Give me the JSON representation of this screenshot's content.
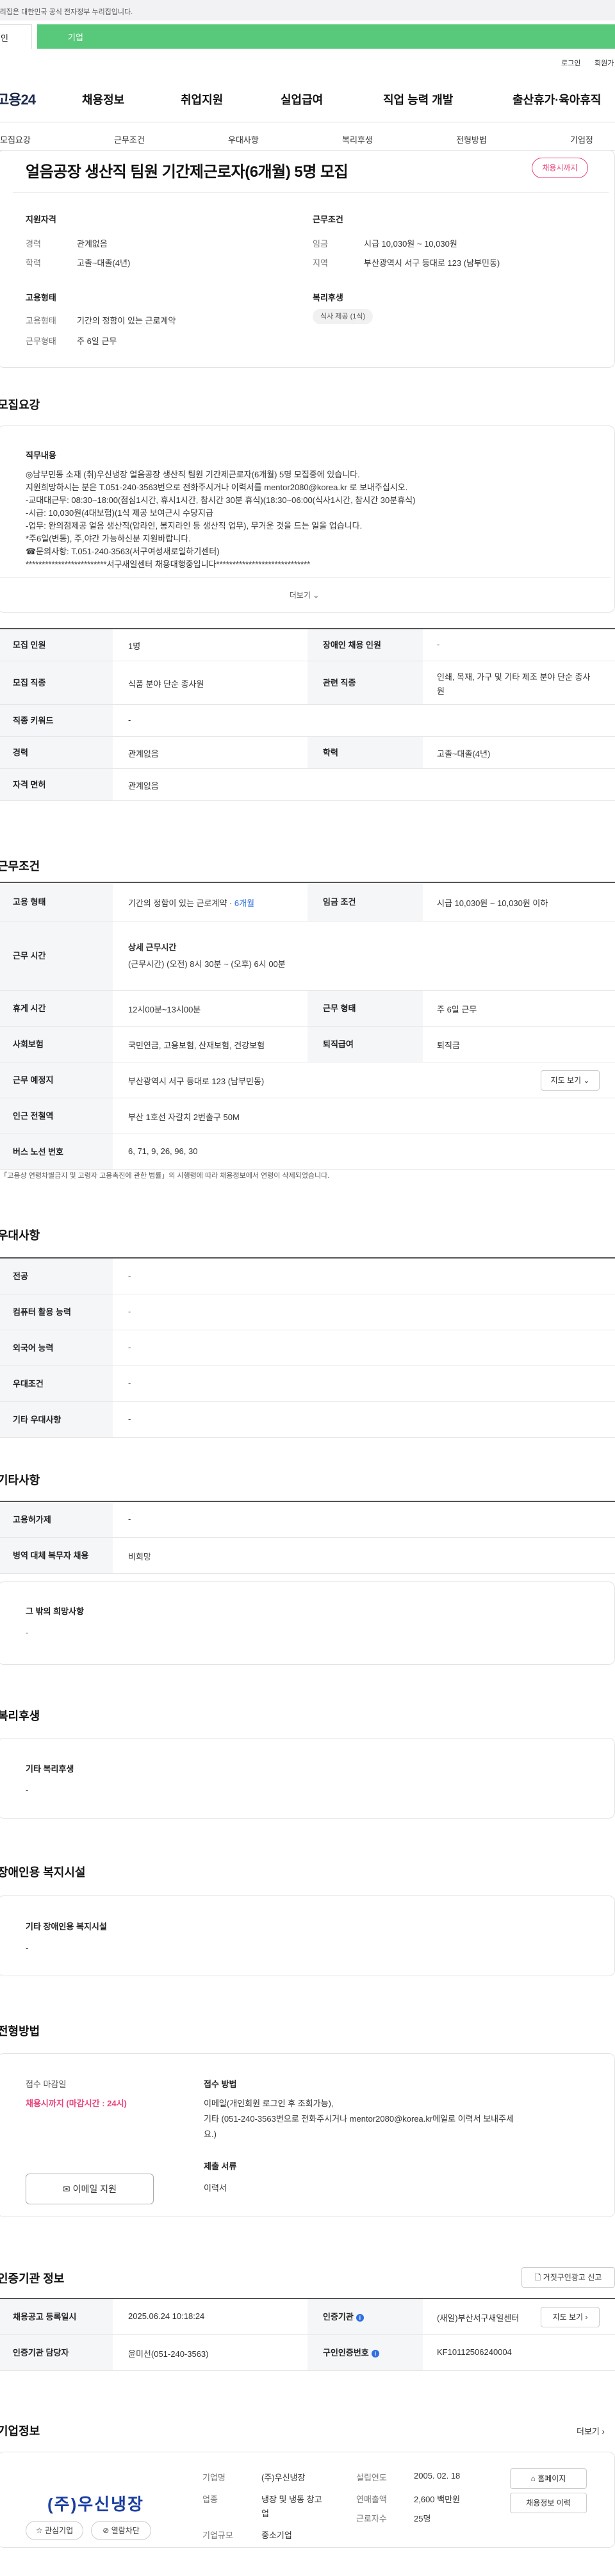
{
  "gov_banner": "·리집은 대한민국 공식 전자정부 누리집입니다.",
  "tabs": {
    "personal": "인",
    "company": "기업"
  },
  "util": {
    "login": "로그인",
    "join": "회원가"
  },
  "header": {
    "logo": "고용24",
    "gnb": [
      "채용정보",
      "취업지원",
      "실업급여",
      "직업 능력 개발",
      "출산휴가·육아휴직"
    ],
    "subnav": [
      "모집요강",
      "근무조건",
      "우대사항",
      "복리후생",
      "전형방법",
      "기업정"
    ]
  },
  "summary": {
    "title": "얼음공장 생산직 팀원 기간제근로자(6개월) 5명 모집",
    "badge": "채용시까지",
    "qual_head": "지원자격",
    "exp_label": "경력",
    "exp_value": "관계없음",
    "edu_label": "학력",
    "edu_value": "고졸~대졸(4년)",
    "cond_head": "근무조건",
    "wage_label": "임금",
    "wage_value": "시급 10,030원 ~ 10,030원",
    "area_label": "지역",
    "area_value": "부산광역시 서구 등대로 123 (남부민동)",
    "emp_head": "고용형태",
    "type_label": "고용형태",
    "type_value": "기간의 정함이 있는 근로계약",
    "days_label": "근무형태",
    "days_value": "주 6일 근무",
    "welfare_head": "복리후생",
    "welfare_chip": "식사 제공 (1식)"
  },
  "recruit": {
    "section_title": "모집요강",
    "desc_head": "직무내용",
    "desc_lines": [
      "◎남부민동 소재 (취)우신냉장 얼음공장 생산직 팀원 기간제근로자(6개월) 5명 모집중에 있습니다.",
      "지원희망하시는 분은 T.051-240-3563번으로 전화주시거나 이력서를 mentor2080@korea.kr 로 보내주십시오.",
      "-교대대근무: 08:30~18:00(점심1시간, 휴시1시간, 참시간 30분 휴식)(18:30~06:00(식사1시간, 참시간 30분휴식)",
      "-시급: 10,030원(4대보험)(1식 제공 보여근시 수당지급",
      "-업무: 완의점제공 얼음 생산직(압라인, 봉지라인 등 생산직 업무), 무거운 것을 드는 일을 업습니다.",
      "*주6일(변동), 주,야간 가능하신분 지원바랍니다.",
      "☎문의사항: T.051-240-3563(서구여성새로일하기센터)",
      "*************************서구새일센터 채용대행중입니다*****************************"
    ],
    "more": "더보기",
    "rows": [
      {
        "l1": "모집 인원",
        "v1": "1명",
        "l2": "장애인 채용 인원",
        "v2": "-"
      },
      {
        "l1": "모집 직종",
        "v1": "식품 분야 단순 종사원",
        "l2": "관련 직종",
        "v2": "인쇄, 목재, 가구 및 기타 제조 분야 단순 종사원"
      },
      {
        "l1": "직종 키워드",
        "v1": "-"
      },
      {
        "l1": "경력",
        "v1": "관계없음",
        "l2": "학력",
        "v2": "고졸~대졸(4년)"
      },
      {
        "l1": "자격 면허",
        "v1": "관계없음"
      }
    ]
  },
  "conditions": {
    "section_title": "근무조건",
    "emp_type_label": "고용 형태",
    "emp_type_value": "기간의 정함이 있는 근로계약 ·",
    "emp_type_months": "6개월",
    "wage_label": "임금 조건",
    "wage_value": "시급 10,030원 ~ 10,030원 이하",
    "hours_label": "근무 시간",
    "hours_head": "상세 근무시간",
    "hours_value": "(근무시간) (오전) 8시 30분 ~ (오후) 6시 00분",
    "break_label": "휴게 시간",
    "break_value": "12시00분~13시00분",
    "form_label": "근무 형태",
    "form_value": "주 6일 근무",
    "insurance_label": "사회보험",
    "insurance_value": "국민연금, 고용보험, 산재보험, 건강보험",
    "severance_label": "퇴직급여",
    "severance_value": "퇴직금",
    "place_label": "근무 예정지",
    "place_value": "부산광역시 서구 등대로 123 (남부민동)",
    "map_btn": "지도 보기",
    "subway_label": "인근 전철역",
    "subway_value": "부산 1호선 자갈치 2번출구 50M",
    "bus_label": "버스 노선 번호",
    "bus_value": "6, 71, 9, 26, 96, 30",
    "note": "*「고용상 연령차별금지 및 고령자 고용촉진에 관한 법률」의 시행령에 따라 채용정보에서 연령이 삭제되었습니다."
  },
  "preference": {
    "section_title": "우대사항",
    "rows": [
      {
        "label": "전공",
        "value": "-"
      },
      {
        "label": "컴퓨터 활용 능력",
        "value": "-"
      },
      {
        "label": "외국어 능력",
        "value": "-"
      },
      {
        "label": "우대조건",
        "value": "-"
      },
      {
        "label": "기타 우대사항",
        "value": "-"
      }
    ]
  },
  "etc": {
    "section_title": "기타사항",
    "rows": [
      {
        "label": "고용허가제",
        "value": "-"
      },
      {
        "label": "병역 대체 복무자 채용",
        "value": "비희망"
      }
    ],
    "hope_head": "그 밖의 희망사항",
    "hope_value": "-"
  },
  "welfare": {
    "section_title": "복리후생",
    "head": "기타 복리후생",
    "value": "-"
  },
  "disability": {
    "section_title": "장애인용 복지시설",
    "head": "기타 장애인용 복지시설",
    "value": "-"
  },
  "selection": {
    "section_title": "전형방법",
    "deadline_head": "접수 마감일",
    "deadline_value": "채용시까지 (마감시간 : 24시)",
    "method_head": "접수 방법",
    "method_lines": [
      "이메일(개인회원 로그인 후 조회가능),",
      "기타 (051-240-3563번으로 전화주시거나 mentor2080@korea.kr메일로 이력서 보내주세",
      "요.)"
    ],
    "docs_head": "제출 서류",
    "docs_value": "이력서",
    "apply_btn": "이메일 지원"
  },
  "agency": {
    "section_title": "인증기관 정보",
    "report_btn": "거짓구인광고 신고",
    "reg_label": "채용공고 등록일시",
    "reg_value": "2025.06.24 10:18:24",
    "org_label": "인증기관",
    "org_value": "(새일)부산서구새일센터",
    "map_btn": "지도 보기",
    "manager_label": "인증기관 담당자",
    "manager_value": "윤미선(051-240-3563)",
    "number_label": "구인인증번호",
    "number_value": "KF10112506240004"
  },
  "company": {
    "section_title": "기업정보",
    "more": "더보기",
    "logo_text": "(주)우신냉장",
    "interest_btn": "관심기업",
    "block_btn": "열람차단",
    "name_label": "기업명",
    "name_value": "(주)우신냉장",
    "biz_label": "업종",
    "biz_value_1": "냉장 및 냉동 창고",
    "biz_value_2": "업",
    "size_label": "기업규모",
    "size_value": "중소기업",
    "year_label": "설립연도",
    "year_value": "2005. 02. 18",
    "sales_label": "연매출액",
    "sales_value": "2,600 백만원",
    "staff_label": "근로자수",
    "staff_value": "25명",
    "home_btn": "홈페이지",
    "jobs_btn": "채용정보 이력"
  }
}
